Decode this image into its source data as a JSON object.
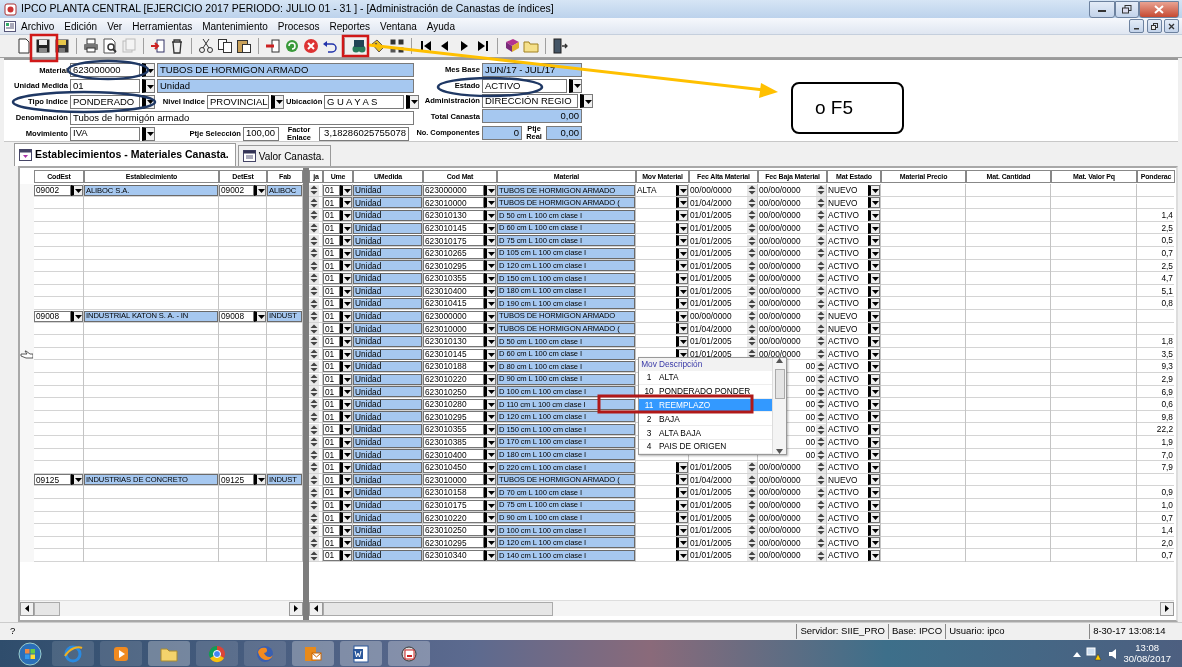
{
  "window": {
    "title": "IPCO PLANTA CENTRAL [EJERCICIO 2017 PERIODO: JULIO 01 - 31 ] - [Administración de Canastas de índices]"
  },
  "menu": [
    "Archivo",
    "Edición",
    "Ver",
    "Herramientas",
    "Mantenimiento",
    "Procesos",
    "Reportes",
    "Ventana",
    "Ayuda"
  ],
  "form": {
    "material": {
      "label": "Material",
      "value": "623000000",
      "description": "TUBOS DE HORMIGON ARMADO"
    },
    "unidad_medida": {
      "label": "Unidad Medida",
      "value": "01",
      "description": "Unidad"
    },
    "tipo_indice": {
      "label": "Tipo Indice",
      "value": "PONDERADO"
    },
    "nivel_indice": {
      "label": "Nivel Indice",
      "value": "PROVINCIAL"
    },
    "ubicacion": {
      "label": "Ubicación",
      "value": "G U A Y A S"
    },
    "denominacion": {
      "label": "Denominación",
      "value": "Tubos de hormigón armado"
    },
    "movimiento": {
      "label": "Movimiento",
      "value": "IVA"
    },
    "ptje_seleccion": {
      "label": "Ptje Selección",
      "value": "100,00"
    },
    "factor_enlace": {
      "label": "Factor Enlace",
      "value": "3,18286025755078"
    },
    "mes_base": {
      "label": "Mes Base",
      "value": "JUN/17 - JUL/17"
    },
    "estado": {
      "label": "Estado",
      "value": "ACTIVO"
    },
    "administracion": {
      "label": "Administración",
      "value": "DIRECCIÓN REGIO"
    },
    "total_canasta": {
      "label": "Total Canasta",
      "value": "0,00"
    },
    "no_componentes": {
      "label": "No. Componentes",
      "value": "0"
    },
    "ptje_real": {
      "label": "Ptje Real",
      "value": "0,00"
    }
  },
  "tabs": [
    {
      "label": "Establecimientos - Materiales Canasta.",
      "selected": true
    },
    {
      "label": "Valor Canasta.",
      "selected": false
    }
  ],
  "grid": {
    "left_columns": [
      "CodEst",
      "Establecimiento",
      "DetEst",
      "Fab"
    ],
    "right_columns": [
      "ja",
      "Ume",
      "UMedida",
      "Cod Mat",
      "Material",
      "Mov Material",
      "Fec Alta Material",
      "Fec Baja Material",
      "Mat Estado",
      "Material Precio",
      "Mat. Cantidad",
      "Mat. Valor Pq",
      "Ponderac"
    ],
    "groups": [
      {
        "codest": "09002",
        "establecimiento": "ALIBOC S.A.",
        "detest": "09002",
        "column_4": "ALIBOC",
        "rows": [
          {
            "ume": "01",
            "umedida": "Unidad",
            "cod_mat": "623000000",
            "material": "TUBOS DE HORMIGON ARMADO",
            "mov": "ALTA",
            "fec_alta": "00/00/0000",
            "fec_baja": "00/00/0000",
            "estado": "NUEVO",
            "current": false
          },
          {
            "ume": "01",
            "umedida": "Unidad",
            "cod_mat": "623010000",
            "material": "TUBOS DE HORMIGON ARMADO (",
            "fec_alta": "01/04/2000",
            "fec_baja": "00/00/0000",
            "estado": "NUEVO",
            "current": false
          },
          {
            "ume": "01",
            "umedida": "Unidad",
            "cod_mat": "623010130",
            "material": "D 50 cm L 100 cm clase I",
            "fec_alta": "01/01/2005",
            "fec_baja": "00/00/0000",
            "estado": "ACTIVO",
            "ponderacion": "1,4",
            "current": false
          },
          {
            "ume": "01",
            "umedida": "Unidad",
            "cod_mat": "623010145",
            "material": "D 60 cm L 100 cm clase I",
            "fec_alta": "01/01/2005",
            "fec_baja": "00/00/0000",
            "estado": "ACTIVO",
            "ponderacion": "2,5",
            "current": false
          },
          {
            "ume": "01",
            "umedida": "Unidad",
            "cod_mat": "623010175",
            "material": "D 75 cm L 100 cm clase I",
            "fec_alta": "01/01/2005",
            "fec_baja": "00/00/0000",
            "estado": "ACTIVO",
            "ponderacion": "0,5",
            "current": false
          },
          {
            "ume": "01",
            "umedida": "Unidad",
            "cod_mat": "623010265",
            "material": "D 105 cm L 100 cm clase I",
            "fec_alta": "01/01/2005",
            "fec_baja": "00/00/0000",
            "estado": "ACTIVO",
            "ponderacion": "0,7",
            "current": false
          },
          {
            "ume": "01",
            "umedida": "Unidad",
            "cod_mat": "623010295",
            "material": "D 120 cm L 100 cm clase I",
            "fec_alta": "01/01/2005",
            "fec_baja": "00/00/0000",
            "estado": "ACTIVO",
            "ponderacion": "2,5",
            "current": false
          },
          {
            "ume": "01",
            "umedida": "Unidad",
            "cod_mat": "623010355",
            "material": "D 150 cm L 100 cm clase I",
            "fec_alta": "01/01/2005",
            "fec_baja": "00/00/0000",
            "estado": "ACTIVO",
            "ponderacion": "4,7",
            "current": false
          },
          {
            "ume": "01",
            "umedida": "Unidad",
            "cod_mat": "623010400",
            "material": "D 180 cm L 100 cm clase I",
            "fec_alta": "01/01/2005",
            "fec_baja": "00/00/0000",
            "estado": "ACTIVO",
            "ponderacion": "5,1",
            "current": false
          },
          {
            "ume": "01",
            "umedida": "Unidad",
            "cod_mat": "623010415",
            "material": "D 190 cm L 100 cm clase I",
            "fec_alta": "01/01/2005",
            "fec_baja": "00/00/0000",
            "estado": "ACTIVO",
            "ponderacion": "0,8",
            "current": false
          }
        ]
      },
      {
        "codest": "09008",
        "establecimiento": "INDUSTRIAL KATON S. A. - IN",
        "detest": "09008",
        "column_4": "INDUST",
        "rows": [
          {
            "ume": "01",
            "umedida": "Unidad",
            "cod_mat": "623000000",
            "material": "TUBOS DE HORMIGON ARMADO",
            "fec_alta": "00/00/0000",
            "fec_baja": "00/00/0000",
            "estado": "NUEVO",
            "current": false
          },
          {
            "ume": "01",
            "umedida": "Unidad",
            "cod_mat": "623010000",
            "material": "TUBOS DE HORMIGON ARMADO (",
            "fec_alta": "01/04/2000",
            "fec_baja": "00/00/0000",
            "estado": "NUEVO",
            "current": false
          },
          {
            "ume": "01",
            "umedida": "Unidad",
            "cod_mat": "623010130",
            "material": "D 50 cm L 100 cm clase I",
            "fec_alta": "01/01/2005",
            "fec_baja": "00/00/0000",
            "estado": "ACTIVO",
            "ponderacion": "1,8",
            "current": false
          },
          {
            "ume": "01",
            "umedida": "Unidad",
            "cod_mat": "623010145",
            "material": "D 60 cm L 100 cm clase I",
            "fec_alta": "01/01/2005",
            "fec_baja": "00/00/0000",
            "estado": "ACTIVO",
            "ponderacion": "3,5",
            "current": true
          },
          {
            "ume": "01",
            "umedida": "Unidad",
            "cod_mat": "623010188",
            "material": "D 80 cm L 100 cm clase I",
            "fec_baja": "00",
            "estado": "ACTIVO",
            "ponderacion": "9,3",
            "current": false
          },
          {
            "ume": "01",
            "umedida": "Unidad",
            "cod_mat": "623010220",
            "material": "D 90 cm L 100 cm clase I",
            "fec_baja": "00",
            "estado": "ACTIVO",
            "ponderacion": "2,9",
            "current": false
          },
          {
            "ume": "01",
            "umedida": "Unidad",
            "cod_mat": "623010250",
            "material": "D 100 cm L 100 cm clase I",
            "fec_baja": "00",
            "estado": "ACTIVO",
            "ponderacion": "6,9",
            "current": false
          },
          {
            "ume": "01",
            "umedida": "Unidad",
            "cod_mat": "623010280",
            "material": "D 110 cm L 100 cm clase I",
            "fec_baja": "00",
            "estado": "ACTIVO",
            "ponderacion": "0,6",
            "current": false
          },
          {
            "ume": "01",
            "umedida": "Unidad",
            "cod_mat": "623010295",
            "material": "D 120 cm L 100 cm clase I",
            "fec_baja": "00",
            "estado": "ACTIVO",
            "ponderacion": "9,8",
            "current": false
          },
          {
            "ume": "01",
            "umedida": "Unidad",
            "cod_mat": "623010355",
            "material": "D 150 cm L 100 cm clase I",
            "fec_baja": "00",
            "estado": "ACTIVO",
            "ponderacion": "22,2",
            "current": false
          },
          {
            "ume": "01",
            "umedida": "Unidad",
            "cod_mat": "623010385",
            "material": "D 170 cm L 100 cm clase I",
            "fec_baja": "00",
            "estado": "ACTIVO",
            "ponderacion": "1,9",
            "current": false
          },
          {
            "ume": "01",
            "umedida": "Unidad",
            "cod_mat": "623010400",
            "material": "D 180 cm L 100 cm clase I",
            "fec_baja": "00",
            "estado": "ACTIVO",
            "ponderacion": "7,0",
            "current": false
          },
          {
            "ume": "01",
            "umedida": "Unidad",
            "cod_mat": "623010450",
            "material": "D 220 cm L 100 cm clase I",
            "fec_alta": "01/01/2005",
            "fec_baja": "00/00/0000",
            "estado": "ACTIVO",
            "ponderacion": "7,9",
            "current": false
          }
        ]
      },
      {
        "codest": "09125",
        "establecimiento": "INDUSTRIAS DE CONCRETO",
        "detest": "09125",
        "column_4": "INDUST",
        "rows": [
          {
            "ume": "01",
            "umedida": "Unidad",
            "cod_mat": "623010000",
            "material": "TUBOS DE HORMIGON ARMADO (",
            "fec_alta": "01/04/2000",
            "fec_baja": "00/00/0000",
            "estado": "NUEVO",
            "current": false
          },
          {
            "ume": "01",
            "umedida": "Unidad",
            "cod_mat": "623010158",
            "material": "D 70 cm L 100 cm clase I",
            "fec_alta": "01/01/2005",
            "fec_baja": "00/00/0000",
            "estado": "ACTIVO",
            "ponderacion": "0,9",
            "current": false
          },
          {
            "ume": "01",
            "umedida": "Unidad",
            "cod_mat": "623010175",
            "material": "D 75 cm L 100 cm clase I",
            "fec_alta": "01/01/2005",
            "fec_baja": "00/00/0000",
            "estado": "ACTIVO",
            "ponderacion": "1,0",
            "current": false
          },
          {
            "ume": "01",
            "umedida": "Unidad",
            "cod_mat": "623010220",
            "material": "D 90 cm L 100 cm clase I",
            "fec_alta": "01/01/2005",
            "fec_baja": "00/00/0000",
            "estado": "ACTIVO",
            "ponderacion": "0,7",
            "current": false
          },
          {
            "ume": "01",
            "umedida": "Unidad",
            "cod_mat": "623010250",
            "material": "D 100 cm L 100 cm clase I",
            "fec_alta": "01/01/2005",
            "fec_baja": "00/00/0000",
            "estado": "ACTIVO",
            "ponderacion": "1,4",
            "current": false
          },
          {
            "ume": "01",
            "umedida": "Unidad",
            "cod_mat": "623010295",
            "material": "D 120 cm L 100 cm clase I",
            "fec_alta": "01/01/2005",
            "fec_baja": "00/00/0000",
            "estado": "ACTIVO",
            "ponderacion": "2,0",
            "current": false
          },
          {
            "ume": "01",
            "umedida": "Unidad",
            "cod_mat": "623010340",
            "material": "D 140 cm L 100 cm clase I",
            "fec_alta": "01/01/2005",
            "fec_baja": "00/00/0000",
            "estado": "ACTIVO",
            "ponderacion": "0,7",
            "current": false
          }
        ]
      }
    ]
  },
  "dropdown": {
    "columns": [
      "Mov",
      "Descripción"
    ],
    "items": [
      {
        "code": "1",
        "label": "ALTA",
        "selected": false
      },
      {
        "code": "10",
        "label": "PONDERADO PONDER",
        "selected": false
      },
      {
        "code": "11",
        "label": "REEMPLAZO",
        "selected": true
      },
      {
        "code": "2",
        "label": "BAJA",
        "selected": false
      },
      {
        "code": "3",
        "label": "ALTA BAJA",
        "selected": false
      },
      {
        "code": "4",
        "label": "PAIS DE ORIGEN",
        "selected": false
      }
    ]
  },
  "status_bar": {
    "hint": "?",
    "panels": [
      "Servidor: SIIE_PRO",
      "Base: IPCO",
      "Usuario: ipco",
      "8-30-17 13:08:14"
    ]
  },
  "taskbar": {
    "time": "13:08",
    "date": "30/08/2017"
  },
  "annotation": {
    "callout": "o F5"
  }
}
